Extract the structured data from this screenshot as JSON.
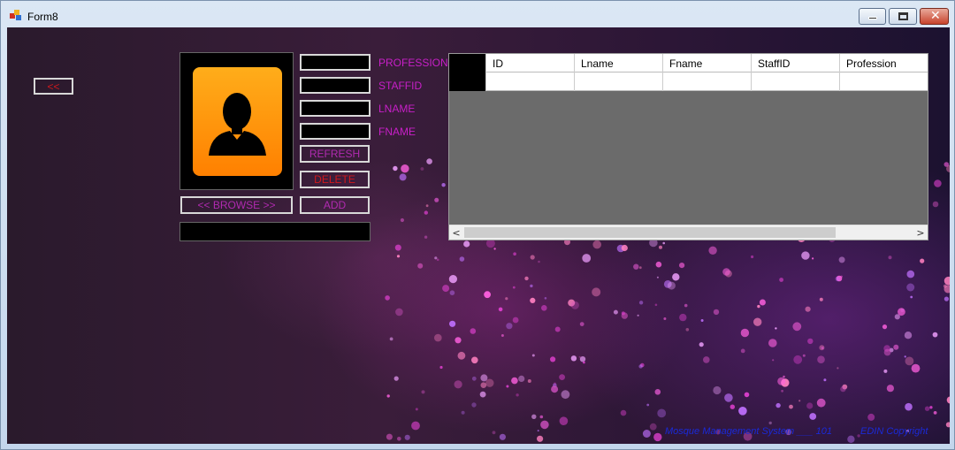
{
  "window": {
    "title": "Form8"
  },
  "back_button": {
    "label": "<<"
  },
  "form": {
    "labels": {
      "profession": "PROFESSION",
      "staffid": "STAFFID",
      "lname": "LNAME",
      "fname": "FNAME"
    },
    "fields": {
      "profession": "",
      "staffid": "",
      "lname": "",
      "fname": "",
      "photo_path": ""
    },
    "buttons": {
      "refresh": "REFRESH",
      "delete": "DELETE",
      "add": "ADD",
      "browse": "<< BROWSE >>"
    }
  },
  "grid": {
    "columns": [
      "ID",
      "Lname",
      "Fname",
      "StaffID",
      "Profession"
    ],
    "rows": [
      [
        "",
        "",
        "",
        "",
        ""
      ]
    ]
  },
  "footer": {
    "left": "Mosque Management System ___ 101",
    "right": "EDIN Copyright"
  },
  "colors": {
    "label_text": "#c81fc8",
    "delete_text": "#d0181c",
    "footer_text": "#1a2ad8",
    "avatar_orange": "#ff9a10"
  }
}
